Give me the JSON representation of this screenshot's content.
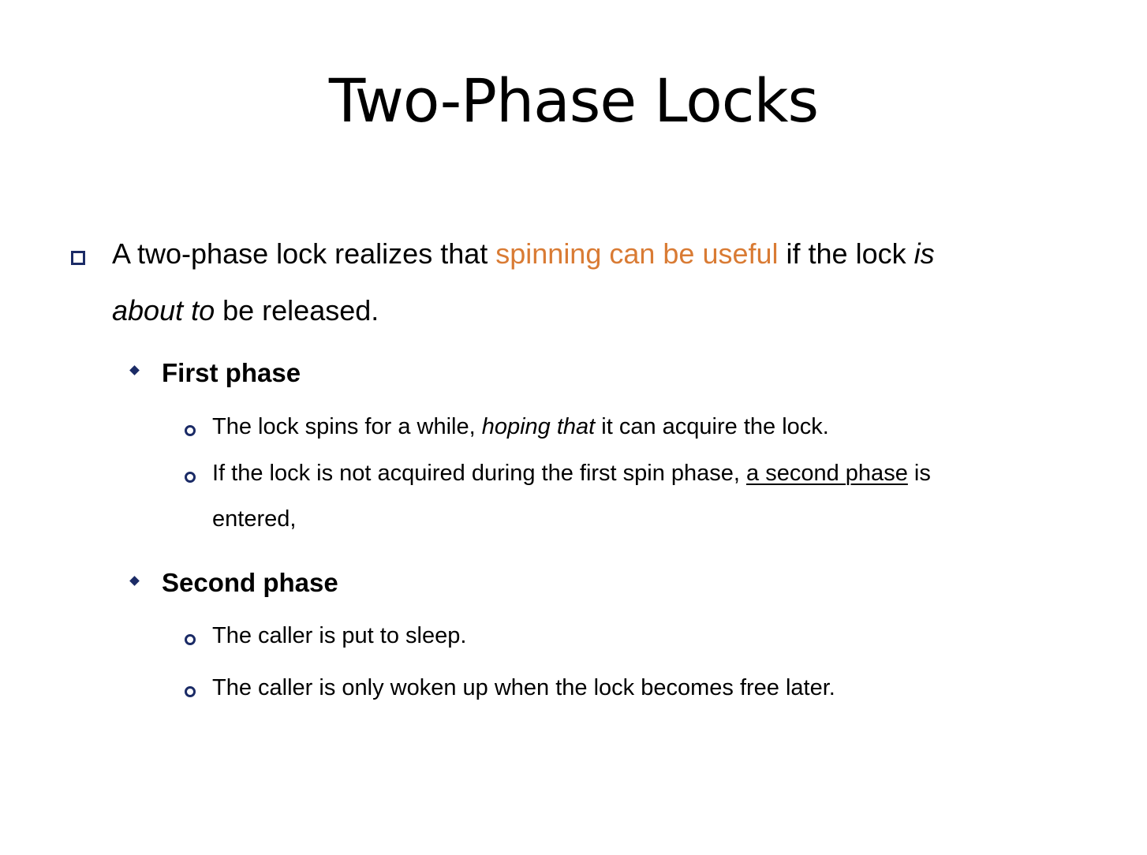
{
  "slide": {
    "title": "Two-Phase Locks",
    "main_bullet": {
      "line1_pre": "A two-phase lock realizes that ",
      "line1_highlight": "spinning can be useful",
      "line1_post": " if the lock ",
      "line1_italic": "is",
      "line2_italic": "about to",
      "line2_post": " be released."
    },
    "first_phase": {
      "heading": "First phase",
      "item1_pre": "The lock spins for a while, ",
      "item1_italic": "hoping that",
      "item1_post": " it can acquire the lock.",
      "item2_pre": "If the lock is not acquired during the first spin phase, ",
      "item2_underline": "a second phase",
      "item2_post": " is",
      "item2_cont": "entered,"
    },
    "second_phase": {
      "heading": "Second phase",
      "item1": "The caller is put to sleep.",
      "item2": "The caller is only woken up when the lock becomes free later."
    }
  },
  "colors": {
    "highlight": "#d97b34",
    "bullet": "#1b2b66"
  },
  "icons": {
    "level1": "hollow-square-bullet",
    "level2": "diamond-bullet",
    "level3": "hollow-circle-bullet"
  }
}
